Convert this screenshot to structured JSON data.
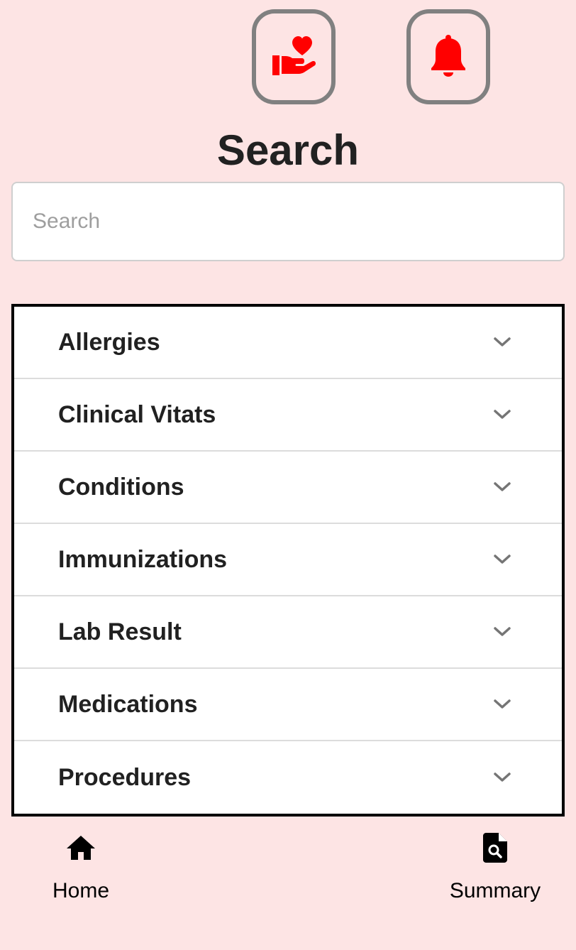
{
  "header": {
    "care_button_icon": "hand-holding-heart-icon",
    "notifications_button_icon": "bell-icon",
    "icon_color": "#ff0000",
    "button_border_color": "#808080"
  },
  "page": {
    "title": "Search",
    "background_color": "#fde4e4"
  },
  "search": {
    "placeholder": "Search",
    "value": ""
  },
  "accordion": {
    "items": [
      {
        "label": "Allergies",
        "icon": "chevron-down-icon"
      },
      {
        "label": "Clinical Vitats",
        "icon": "chevron-down-icon"
      },
      {
        "label": "Conditions",
        "icon": "chevron-down-icon"
      },
      {
        "label": "Immunizations",
        "icon": "chevron-down-icon"
      },
      {
        "label": "Lab Result",
        "icon": "chevron-down-icon"
      },
      {
        "label": "Medications",
        "icon": "chevron-down-icon"
      },
      {
        "label": "Procedures",
        "icon": "chevron-down-icon"
      }
    ]
  },
  "bottom_nav": {
    "home": {
      "label": "Home",
      "icon": "home-icon"
    },
    "summary": {
      "label": "Summary",
      "icon": "file-search-icon"
    }
  }
}
